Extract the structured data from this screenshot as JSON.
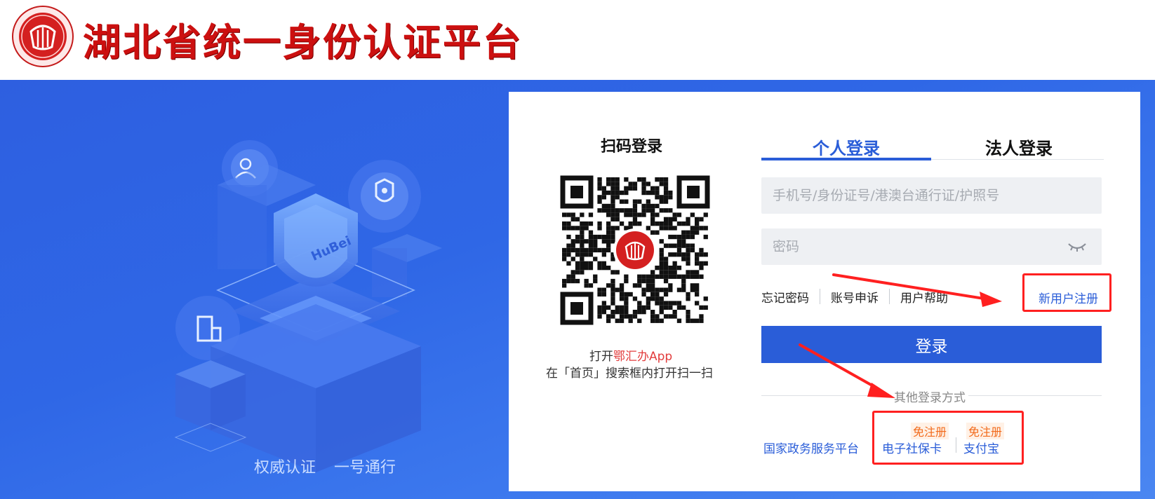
{
  "header": {
    "title": "湖北省统一身份认证平台",
    "logo_icon": "emblem-logo-icon"
  },
  "hero": {
    "slogan_left": "权威认证",
    "slogan_right": "一号通行",
    "shield_text": "HuBei"
  },
  "qr": {
    "title": "扫码登录",
    "hint_prefix": "打开",
    "hint_app": "鄂汇办App",
    "hint_line2": "在「首页」搜索框内打开扫一扫"
  },
  "tabs": [
    {
      "label": "个人登录",
      "active": true
    },
    {
      "label": "法人登录",
      "active": false
    }
  ],
  "form": {
    "account_placeholder": "手机号/身份证号/港澳台通行证/护照号",
    "password_placeholder": "密码",
    "forgot": "忘记密码",
    "appeal": "账号申诉",
    "help": "用户帮助",
    "register": "新用户注册",
    "login_button": "登录"
  },
  "other_login": {
    "label": "其他登录方式",
    "national": "国家政务服务平台",
    "social_card": "电子社保卡",
    "alipay": "支付宝",
    "badge_1": "免注册",
    "badge_2": "免注册"
  },
  "colors": {
    "primary": "#2a5dd8",
    "title_red": "#cc1010",
    "annotation": "#ff2020",
    "badge_orange": "#f26a1b"
  }
}
